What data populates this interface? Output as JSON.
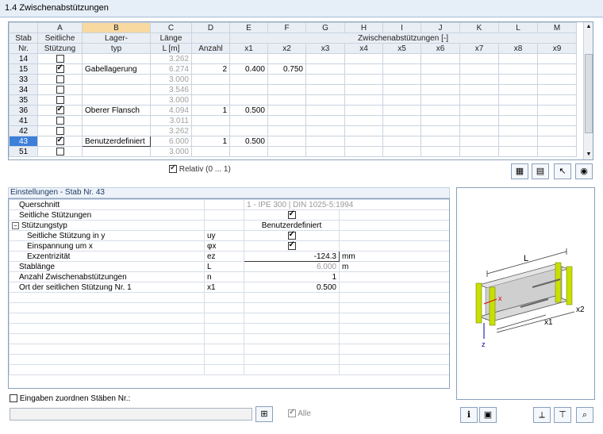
{
  "window": {
    "title": "1.4 Zwischenabstützungen"
  },
  "grid": {
    "col_letters": [
      "A",
      "B",
      "C",
      "D",
      "E",
      "F",
      "G",
      "H",
      "I",
      "J",
      "K",
      "L",
      "M"
    ],
    "header": {
      "stab": "Stab",
      "nr": "Nr.",
      "a1": "Seitliche",
      "a2": "Stützung",
      "b1": "Lager-",
      "b2": "typ",
      "c1": "Länge",
      "c2": "L [m]",
      "d": "Anzahl",
      "group": "Zwischenabstützungen [-]",
      "x": [
        "x1",
        "x2",
        "x3",
        "x4",
        "x5",
        "x6",
        "x7",
        "x8",
        "x9"
      ]
    },
    "rows": [
      {
        "nr": "14",
        "checked": false,
        "typ": "",
        "laenge": "3.262",
        "anzahl": "",
        "x1": "",
        "x2": ""
      },
      {
        "nr": "15",
        "checked": true,
        "typ": "Gabellagerung",
        "laenge": "6.274",
        "anzahl": "2",
        "x1": "0.400",
        "x2": "0.750"
      },
      {
        "nr": "33",
        "checked": false,
        "typ": "",
        "laenge": "3.000",
        "anzahl": "",
        "x1": "",
        "x2": ""
      },
      {
        "nr": "34",
        "checked": false,
        "typ": "",
        "laenge": "3.546",
        "anzahl": "",
        "x1": "",
        "x2": ""
      },
      {
        "nr": "35",
        "checked": false,
        "typ": "",
        "laenge": "3.000",
        "anzahl": "",
        "x1": "",
        "x2": ""
      },
      {
        "nr": "36",
        "checked": true,
        "typ": "Oberer Flansch",
        "laenge": "4.094",
        "anzahl": "1",
        "x1": "0.500",
        "x2": ""
      },
      {
        "nr": "41",
        "checked": false,
        "typ": "",
        "laenge": "3.011",
        "anzahl": "",
        "x1": "",
        "x2": ""
      },
      {
        "nr": "42",
        "checked": false,
        "typ": "",
        "laenge": "3.262",
        "anzahl": "",
        "x1": "",
        "x2": ""
      },
      {
        "nr": "43",
        "checked": true,
        "typ": "Benutzerdefiniert",
        "laenge": "6.000",
        "anzahl": "1",
        "x1": "0.500",
        "x2": "",
        "active": true
      },
      {
        "nr": "51",
        "checked": false,
        "typ": "",
        "laenge": "3.000",
        "anzahl": "",
        "x1": "",
        "x2": ""
      }
    ],
    "relativ_label": "Relativ (0 ... 1)"
  },
  "settings": {
    "title": "Einstellungen - Stab Nr. 43",
    "rows": {
      "querschnitt": {
        "label": "Querschnitt",
        "value": "1 - IPE 300 | DIN 1025-5:1994"
      },
      "seitliche": {
        "label": "Seitliche Stützungen"
      },
      "stuetzungstyp": {
        "label": "Stützungstyp",
        "value": "Benutzerdefiniert"
      },
      "stuetzung_y": {
        "label": "Seitliche Stützung in y",
        "sym": "uy"
      },
      "einspannung": {
        "label": "Einspannung um x",
        "sym": "φx"
      },
      "exzentrizitaet": {
        "label": "Exzentrizität",
        "sym": "ez",
        "value": "-124.3",
        "unit": "mm"
      },
      "stablaenge": {
        "label": "Stablänge",
        "sym": "L",
        "value": "6.000",
        "unit": "m"
      },
      "anzahl": {
        "label": "Anzahl Zwischenabstützungen",
        "sym": "n",
        "value": "1"
      },
      "ort": {
        "label": "Ort der seitlichen Stützung Nr. 1",
        "sym": "x1",
        "value": "0.500"
      }
    }
  },
  "preview": {
    "labels": {
      "L": "L",
      "x1": "x1",
      "x2": "x2",
      "x": "x",
      "z": "z"
    }
  },
  "bottom": {
    "zuordnen_label": "Eingaben zuordnen Stäben Nr.:",
    "alle_label": "Alle"
  },
  "colors": {
    "accent": "#3d7fd8",
    "header_bg": "#e9eef5",
    "beam_support": "#c8e000"
  }
}
